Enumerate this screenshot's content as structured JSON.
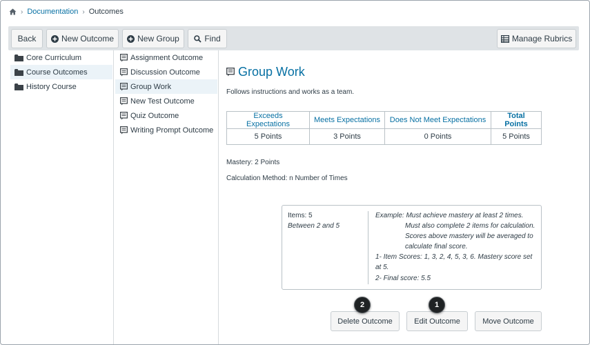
{
  "breadcrumb": {
    "home_icon": "home-icon",
    "items": [
      "Documentation",
      "Outcomes"
    ]
  },
  "toolbar": {
    "back": "Back",
    "new_outcome": "New Outcome",
    "new_group": "New Group",
    "find": "Find",
    "manage_rubrics": "Manage Rubrics"
  },
  "groups": [
    {
      "label": "Core Curriculum",
      "icon": "folder-icon",
      "selected": false
    },
    {
      "label": "Course Outcomes",
      "icon": "folder-icon",
      "selected": true
    },
    {
      "label": "History Course",
      "icon": "folder-icon",
      "selected": false
    }
  ],
  "outcomes": [
    {
      "label": "Assignment Outcome",
      "icon": "outcome-icon",
      "selected": false
    },
    {
      "label": "Discussion Outcome",
      "icon": "outcome-icon",
      "selected": false
    },
    {
      "label": "Group Work",
      "icon": "outcome-icon",
      "selected": true
    },
    {
      "label": "New Test Outcome",
      "icon": "outcome-icon",
      "selected": false
    },
    {
      "label": "Quiz Outcome",
      "icon": "outcome-icon",
      "selected": false
    },
    {
      "label": "Writing Prompt Outcome",
      "icon": "outcome-icon",
      "selected": false
    }
  ],
  "detail": {
    "title": "Group Work",
    "description": "Follows instructions and works as a team.",
    "ratings": {
      "headers": [
        "Exceeds Expectations",
        "Meets Expectations",
        "Does Not Meet Expectations",
        "Total Points"
      ],
      "values": [
        "5 Points",
        "3 Points",
        "0 Points",
        "5 Points"
      ]
    },
    "mastery": "Mastery: 2 Points",
    "calculation": "Calculation Method: n Number of Times",
    "example": {
      "items": "Items: 5",
      "range": "Between 2 and 5",
      "lines": [
        "Example: Must achieve mastery at least 2 times.",
        "Must also complete 2 items for calculation.",
        "Scores above mastery will be averaged to",
        "calculate final score.",
        "1- Item Scores: 1, 3, 2, 4, 5, 3, 6. Mastery score set",
        "at 5.",
        "2- Final score: 5.5"
      ]
    }
  },
  "actions": {
    "delete": "Delete Outcome",
    "edit": "Edit Outcome",
    "move": "Move Outcome"
  },
  "callouts": [
    "2",
    "1"
  ],
  "colors": {
    "link": "#0770a3",
    "toolbar_bg": "#dfe3e6",
    "selected_bg": "#ebf3f8",
    "badge": "#1f2224"
  }
}
